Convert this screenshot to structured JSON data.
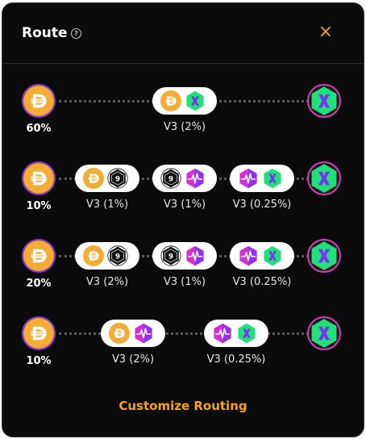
{
  "header": {
    "title": "Route",
    "help_icon": "question-circle-icon",
    "close_icon": "x-icon",
    "close_symbol": "×"
  },
  "colors": {
    "accent": "#f7a21b",
    "background": "#0b0b0c",
    "token_in": "#f5ac37",
    "token_out": "#20e07a"
  },
  "routes": [
    {
      "percent": "60%",
      "hops": [
        {
          "label": "V3 (2%)",
          "tokens": [
            "dai",
            "green-x"
          ]
        }
      ]
    },
    {
      "percent": "10%",
      "hops": [
        {
          "label": "V3 (1%)",
          "tokens": [
            "dai",
            "nine"
          ]
        },
        {
          "label": "V3 (1%)",
          "tokens": [
            "nine",
            "pulse"
          ]
        },
        {
          "label": "V3 (0.25%)",
          "tokens": [
            "pulse",
            "green-x"
          ]
        }
      ]
    },
    {
      "percent": "20%",
      "hops": [
        {
          "label": "V3 (2%)",
          "tokens": [
            "dai",
            "nine"
          ]
        },
        {
          "label": "V3 (1%)",
          "tokens": [
            "nine",
            "pulse"
          ]
        },
        {
          "label": "V3 (0.25%)",
          "tokens": [
            "pulse",
            "green-x"
          ]
        }
      ]
    },
    {
      "percent": "10%",
      "hops": [
        {
          "label": "V3 (2%)",
          "tokens": [
            "dai",
            "pulse"
          ]
        },
        {
          "label": "V3 (0.25%)",
          "tokens": [
            "pulse",
            "green-x"
          ]
        }
      ]
    }
  ],
  "footer": {
    "customize_label": "Customize Routing"
  }
}
